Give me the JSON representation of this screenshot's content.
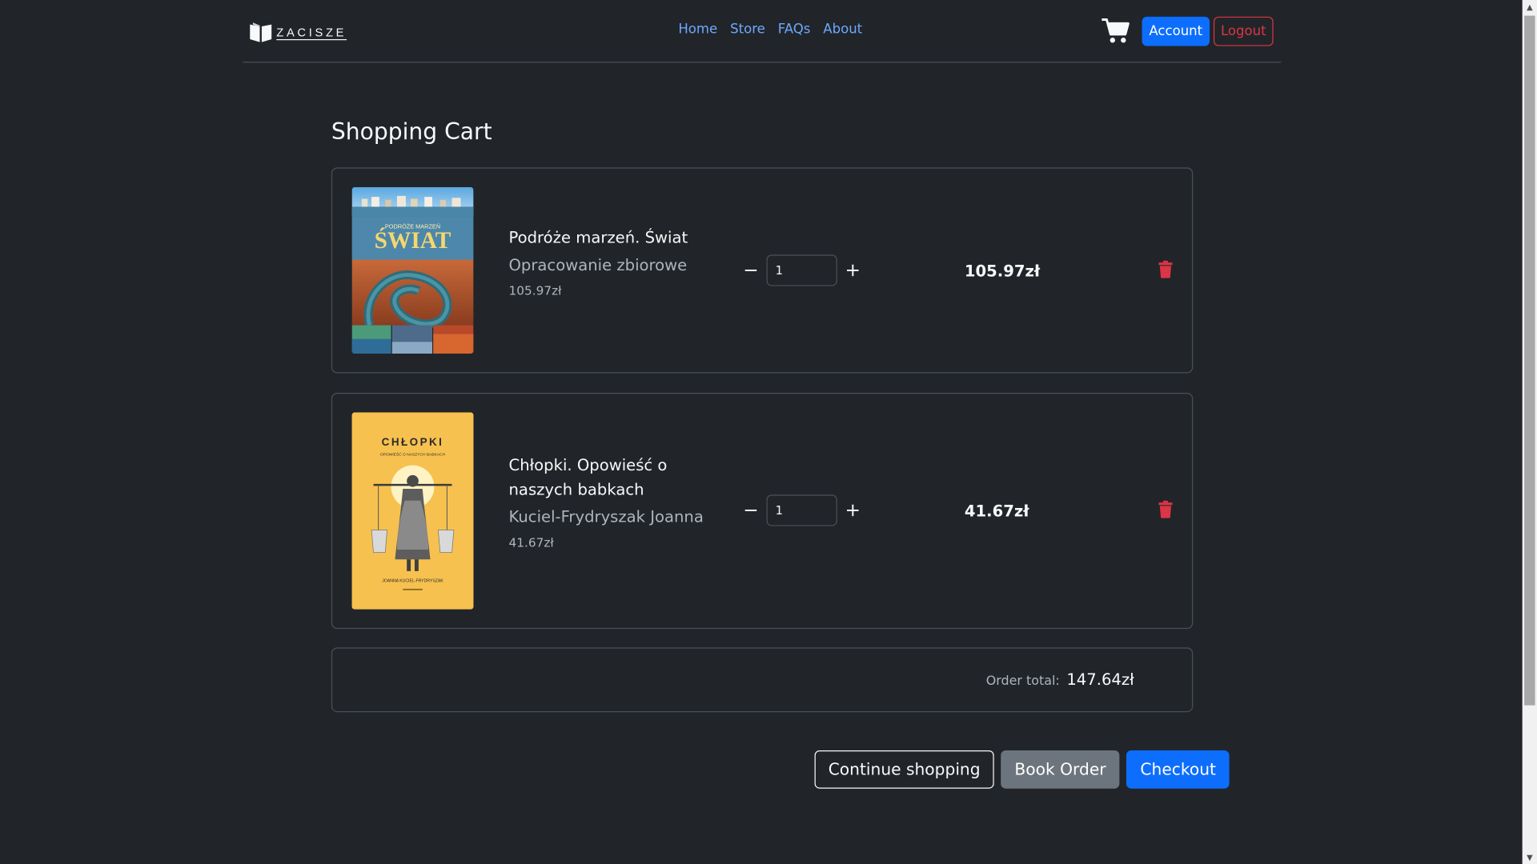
{
  "header": {
    "brand_name": "ZACISZE",
    "nav": [
      {
        "label": "Home"
      },
      {
        "label": "Store"
      },
      {
        "label": "FAQs"
      },
      {
        "label": "About"
      }
    ],
    "account_label": "Account",
    "logout_label": "Logout"
  },
  "cart": {
    "title": "Shopping Cart",
    "items": [
      {
        "cover_title_top": "PODRÓŻE MARZEŃ",
        "cover_title_main": "ŚWIAT",
        "title": "Podróże marzeń. Świat",
        "author": "Opracowanie zbiorowe",
        "price": "105.97zł",
        "quantity": "1",
        "line_total": "105.97zł"
      },
      {
        "cover_title_main": "CHŁOPKI",
        "cover_subtitle": "OPOWIEŚĆ O NASZYCH BABKACH",
        "cover_author": "JOANNA KUCIEL-FRYDRYSZAK",
        "title": "Chłopki. Opowieść o naszych babkach",
        "author": "Kuciel-Frydryszak Joanna",
        "price": "41.67zł",
        "quantity": "1",
        "line_total": "41.67zł"
      }
    ],
    "order_total_label": "Order total:",
    "order_total_value": "147.64zł",
    "buttons": {
      "continue": "Continue shopping",
      "book": "Book Order",
      "checkout": "Checkout"
    }
  },
  "colors": {
    "background": "#212529",
    "primary": "#0d6efd",
    "danger": "#dc3545",
    "secondary": "#6c757d",
    "link": "#6ea8fe"
  }
}
